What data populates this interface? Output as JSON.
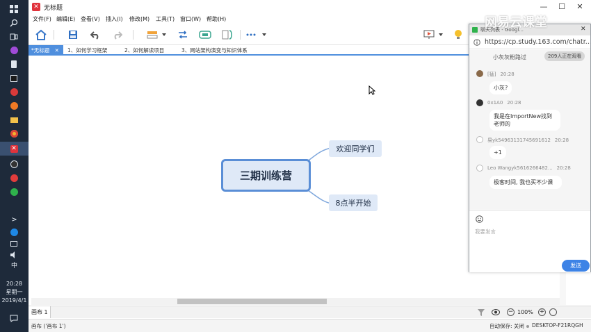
{
  "taskbar": {
    "clock_time": "20:28",
    "clock_weekday": "星期一",
    "clock_date": "2019/4/1",
    "ime": "中",
    "search_icon": "search-icon",
    "expand": ">"
  },
  "window": {
    "title": "无标题",
    "logo_glyph": "✕",
    "min": "—",
    "max": "☐",
    "close": "✕"
  },
  "menu": {
    "items": [
      "文件(F)",
      "编辑(E)",
      "查看(V)",
      "插入(I)",
      "修改(M)",
      "工具(T)",
      "窗口(W)",
      "帮助(H)"
    ]
  },
  "tabs": [
    {
      "label": "*无标题",
      "close": "✕"
    },
    {
      "label": "1、如何学习框架"
    },
    {
      "label": "2、如何解读项目"
    },
    {
      "label": "3、网站架构演变与知识体系"
    }
  ],
  "mindmap": {
    "root": "三期训练营",
    "children": [
      "欢迎同学们",
      "8点半开始"
    ]
  },
  "sheet": {
    "tab_label": "画布 1",
    "zoom": "100%"
  },
  "status": {
    "left": "画布 ('画布 1')",
    "autosave": "自动保存: 关闭",
    "computer": "DESKTOP-F21RQGH"
  },
  "chat": {
    "window_title": "聊天列表 - Googl...",
    "url": "https://cp.study.163.com/chatr...",
    "top_message": "小灰灰粉路过",
    "viewers_badge": "209人正在观看",
    "messages": [
      {
        "user": "[猛]",
        "time": "20:28",
        "text": "小灰?"
      },
      {
        "user": "0x1A0",
        "time": "20:28",
        "text": "我是在ImportNew找到老师的"
      },
      {
        "user": "易yk5496313174569161​2",
        "time": "20:28",
        "text": "+1"
      },
      {
        "user": "Leo Wangyk5616266482...",
        "time": "20:28",
        "text": "极客时间, 我也买不少课"
      }
    ],
    "input_placeholder": "我要发言",
    "send_label": "发送"
  },
  "watermark": "网易云课堂",
  "colors": {
    "accent": "#4f8fde",
    "node_fill": "#dfe9f7",
    "root_border": "#5a8ed6",
    "send": "#3d83e6",
    "app_red": "#e0333c"
  }
}
